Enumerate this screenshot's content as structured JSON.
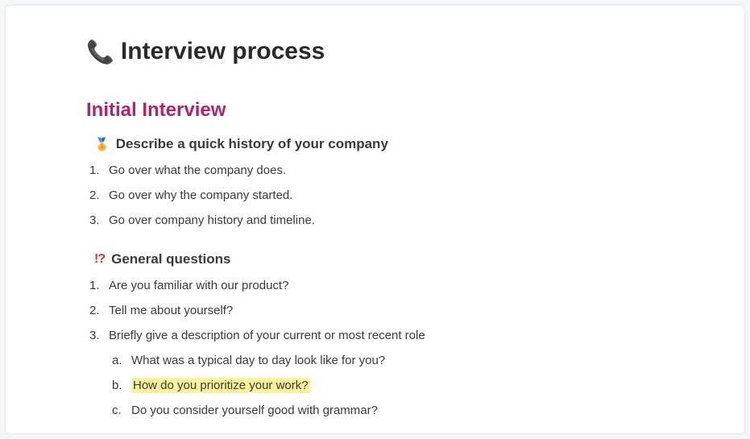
{
  "page": {
    "icon": "📞",
    "title": "Interview process"
  },
  "section1": {
    "heading": "Initial Interview",
    "sub_icon": "🏅",
    "sub_heading": "Describe a quick history of your company",
    "items": [
      "Go over what the company does.",
      "Go over why the company started.",
      "Go over company history and timeline."
    ]
  },
  "section2": {
    "sub_icon": "!?",
    "sub_heading": "General questions",
    "items": {
      "0": "Are you familiar with our product?",
      "1": "Tell me about yourself?",
      "2": {
        "text": "Briefly give a description of your current or most recent role",
        "sub": {
          "0": "What was a typical day to day look like for you?",
          "1": "How do you prioritize your work?",
          "2": "Do you consider yourself good with grammar?"
        }
      }
    }
  }
}
